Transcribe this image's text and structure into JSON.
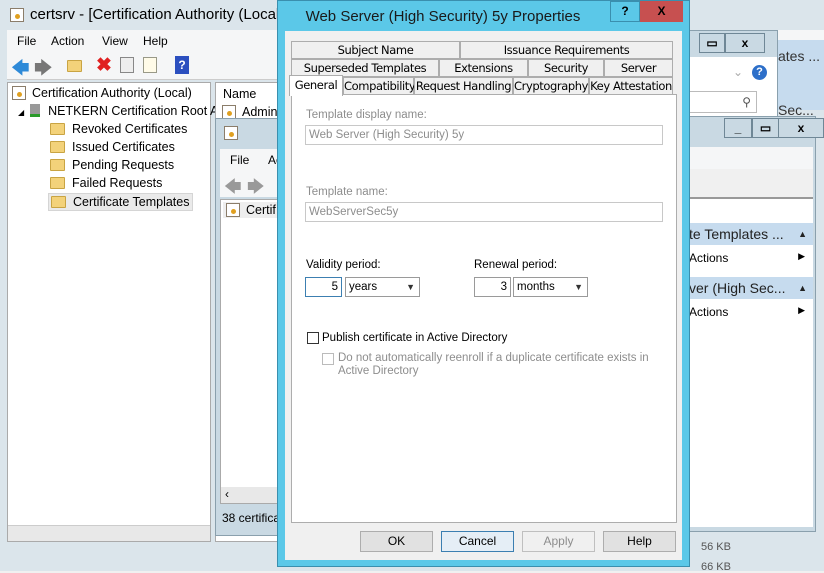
{
  "main_window": {
    "title": "certsrv - [Certification Authority (Local)]",
    "menu": [
      "File",
      "Action",
      "View",
      "Help"
    ],
    "tree": {
      "root": "Certification Authority (Local)",
      "ca": "NETKERN Certification Root A",
      "folders": [
        "Revoked Certificates",
        "Issued Certificates",
        "Pending Requests",
        "Failed Requests",
        "Certificate Templates"
      ]
    },
    "list_header": "Name",
    "list_item": "Admini"
  },
  "template_console": {
    "menu": [
      "File",
      "Ac"
    ],
    "list_item": "Certif",
    "status": "38 certifica"
  },
  "background_windows": {
    "actions_header_1": "te Templates ...",
    "actions_item_1": "Actions",
    "actions_header_2": "ver (High Sec...",
    "actions_item_2": "Actions",
    "behind_header_1": "ates ...",
    "behind_header_2": "Sec...",
    "sizes": [
      "56 KB",
      "66 KB"
    ]
  },
  "dialog": {
    "title": "Web Server (High Security) 5y Properties",
    "help_btn": "?",
    "close_btn": "X",
    "tabs_row1": [
      "Subject Name",
      "Issuance Requirements"
    ],
    "tabs_row2": [
      "Superseded Templates",
      "Extensions",
      "Security",
      "Server"
    ],
    "tabs_row3": [
      "General",
      "Compatibility",
      "Request Handling",
      "Cryptography",
      "Key Attestation"
    ],
    "active_tab": "General",
    "display_name_label": "Template display name:",
    "display_name_value": "Web Server (High Security) 5y",
    "template_name_label": "Template name:",
    "template_name_value": "WebServerSec5y",
    "validity_label": "Validity period:",
    "validity_value": "5",
    "validity_unit": "years",
    "renewal_label": "Renewal period:",
    "renewal_value": "3",
    "renewal_unit": "months",
    "publish_label": "Publish certificate in Active Directory",
    "publish_checked": false,
    "reenroll_label": "Do not automatically reenroll if a duplicate certificate exists in Active Directory",
    "reenroll_checked": false,
    "buttons": {
      "ok": "OK",
      "cancel": "Cancel",
      "apply": "Apply",
      "help": "Help"
    }
  },
  "colors": {
    "dialog_frame": "#5bc8e8",
    "close_red": "#c75050",
    "help_blue": "#2d6fc9"
  }
}
